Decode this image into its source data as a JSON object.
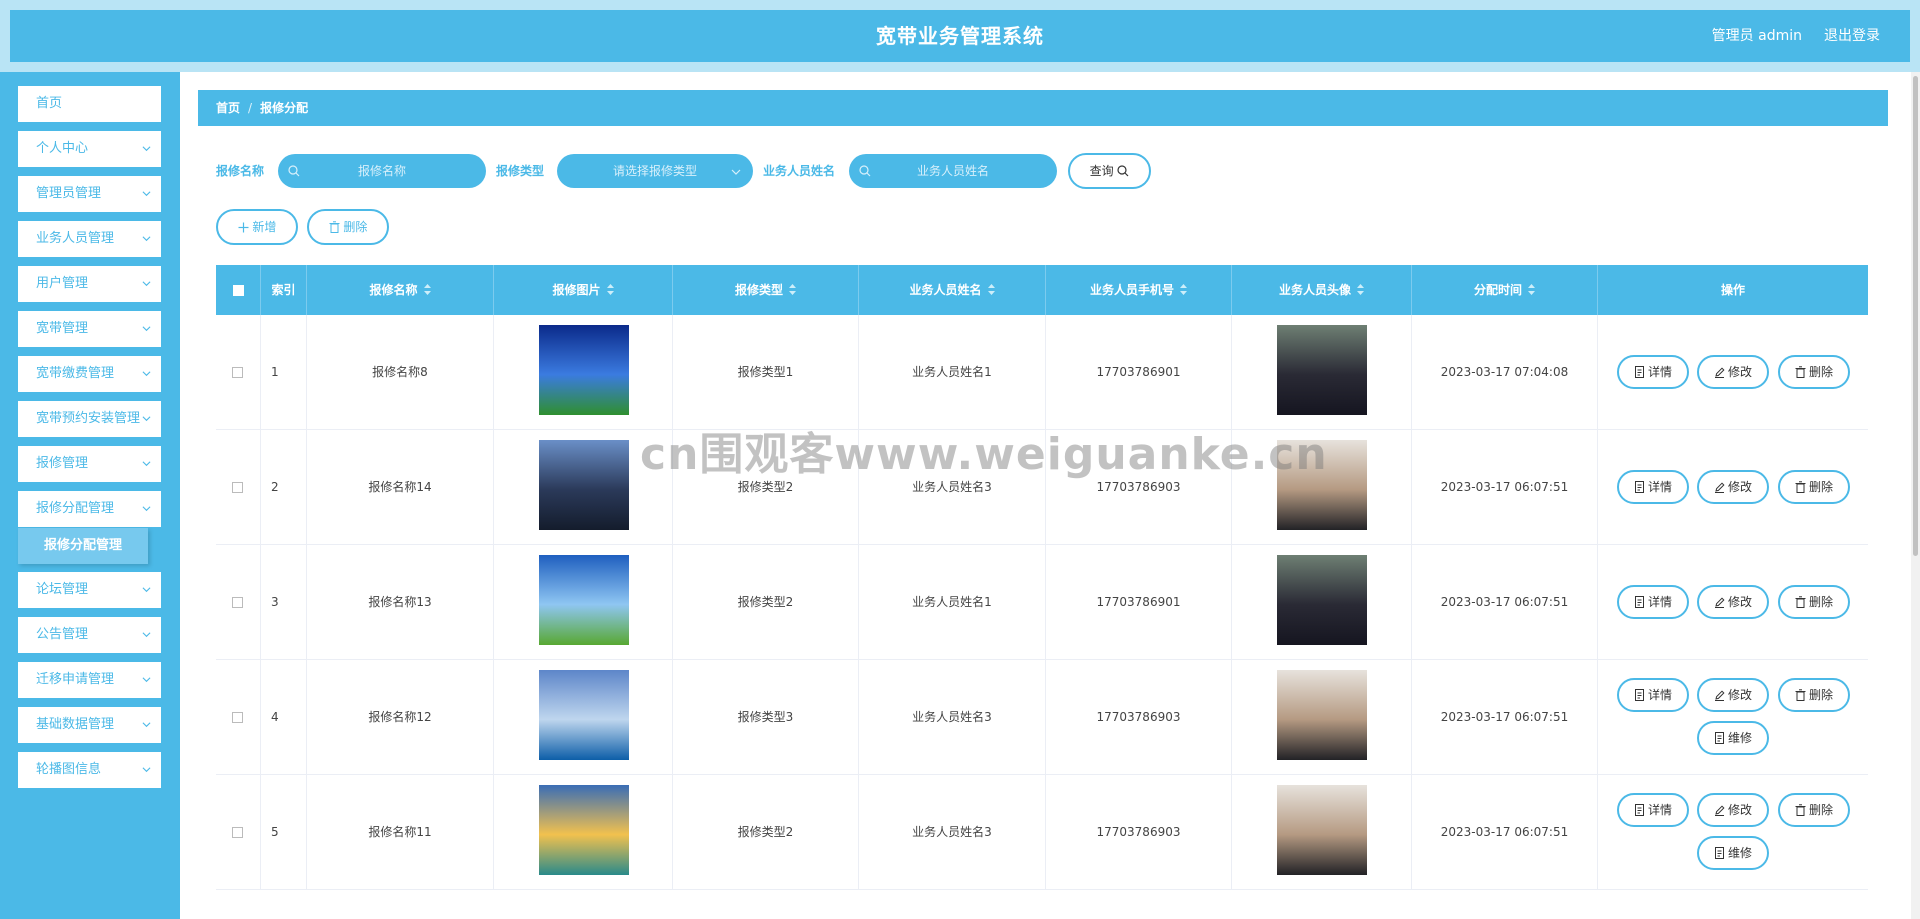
{
  "header": {
    "title": "宽带业务管理系统",
    "user": "管理员 admin",
    "logout": "退出登录"
  },
  "sidebar": {
    "items": [
      {
        "label": "首页"
      },
      {
        "label": "个人中心"
      },
      {
        "label": "管理员管理"
      },
      {
        "label": "业务人员管理"
      },
      {
        "label": "用户管理"
      },
      {
        "label": "宽带管理"
      },
      {
        "label": "宽带缴费管理"
      },
      {
        "label": "宽带预约安装管理"
      },
      {
        "label": "报修管理"
      },
      {
        "label": "报修分配管理"
      },
      {
        "label": "论坛管理"
      },
      {
        "label": "公告管理"
      },
      {
        "label": "迁移申请管理"
      },
      {
        "label": "基础数据管理"
      },
      {
        "label": "轮播图信息"
      }
    ],
    "active_sub": "报修分配管理"
  },
  "breadcrumb": {
    "home": "首页",
    "sep": "/",
    "current": "报修分配"
  },
  "filters": {
    "name_label": "报修名称",
    "name_placeholder": "报修名称",
    "type_label": "报修类型",
    "type_placeholder": "请选择报修类型",
    "staff_label": "业务人员姓名",
    "staff_placeholder": "业务人员姓名",
    "query": "查询"
  },
  "toolbar": {
    "add": "新增",
    "delete": "删除"
  },
  "table": {
    "headers": [
      "索引",
      "报修名称",
      "报修图片",
      "报修类型",
      "业务人员姓名",
      "业务人员手机号",
      "业务人员头像",
      "分配时间",
      "操作"
    ],
    "rows": [
      {
        "index": "1",
        "name": "报修名称8",
        "type": "报修类型1",
        "staff": "业务人员姓名1",
        "phone": "17703786901",
        "time": "2023-03-17 07:04:08"
      },
      {
        "index": "2",
        "name": "报修名称14",
        "type": "报修类型2",
        "staff": "业务人员姓名3",
        "phone": "17703786903",
        "time": "2023-03-17 06:07:51"
      },
      {
        "index": "3",
        "name": "报修名称13",
        "type": "报修类型2",
        "staff": "业务人员姓名1",
        "phone": "17703786901",
        "time": "2023-03-17 06:07:51"
      },
      {
        "index": "4",
        "name": "报修名称12",
        "type": "报修类型3",
        "staff": "业务人员姓名3",
        "phone": "17703786903",
        "time": "2023-03-17 06:07:51"
      },
      {
        "index": "5",
        "name": "报修名称11",
        "type": "报修类型2",
        "staff": "业务人员姓名3",
        "phone": "17703786903",
        "time": "2023-03-17 06:07:51"
      }
    ],
    "actions": {
      "detail": "详情",
      "edit": "修改",
      "delete": "删除",
      "repair": "维修"
    }
  },
  "watermark": "cn围观客www.weiguanke.cn",
  "colors": {
    "accent": "#4bb9e7",
    "accent_light": "#b9e4f5"
  }
}
